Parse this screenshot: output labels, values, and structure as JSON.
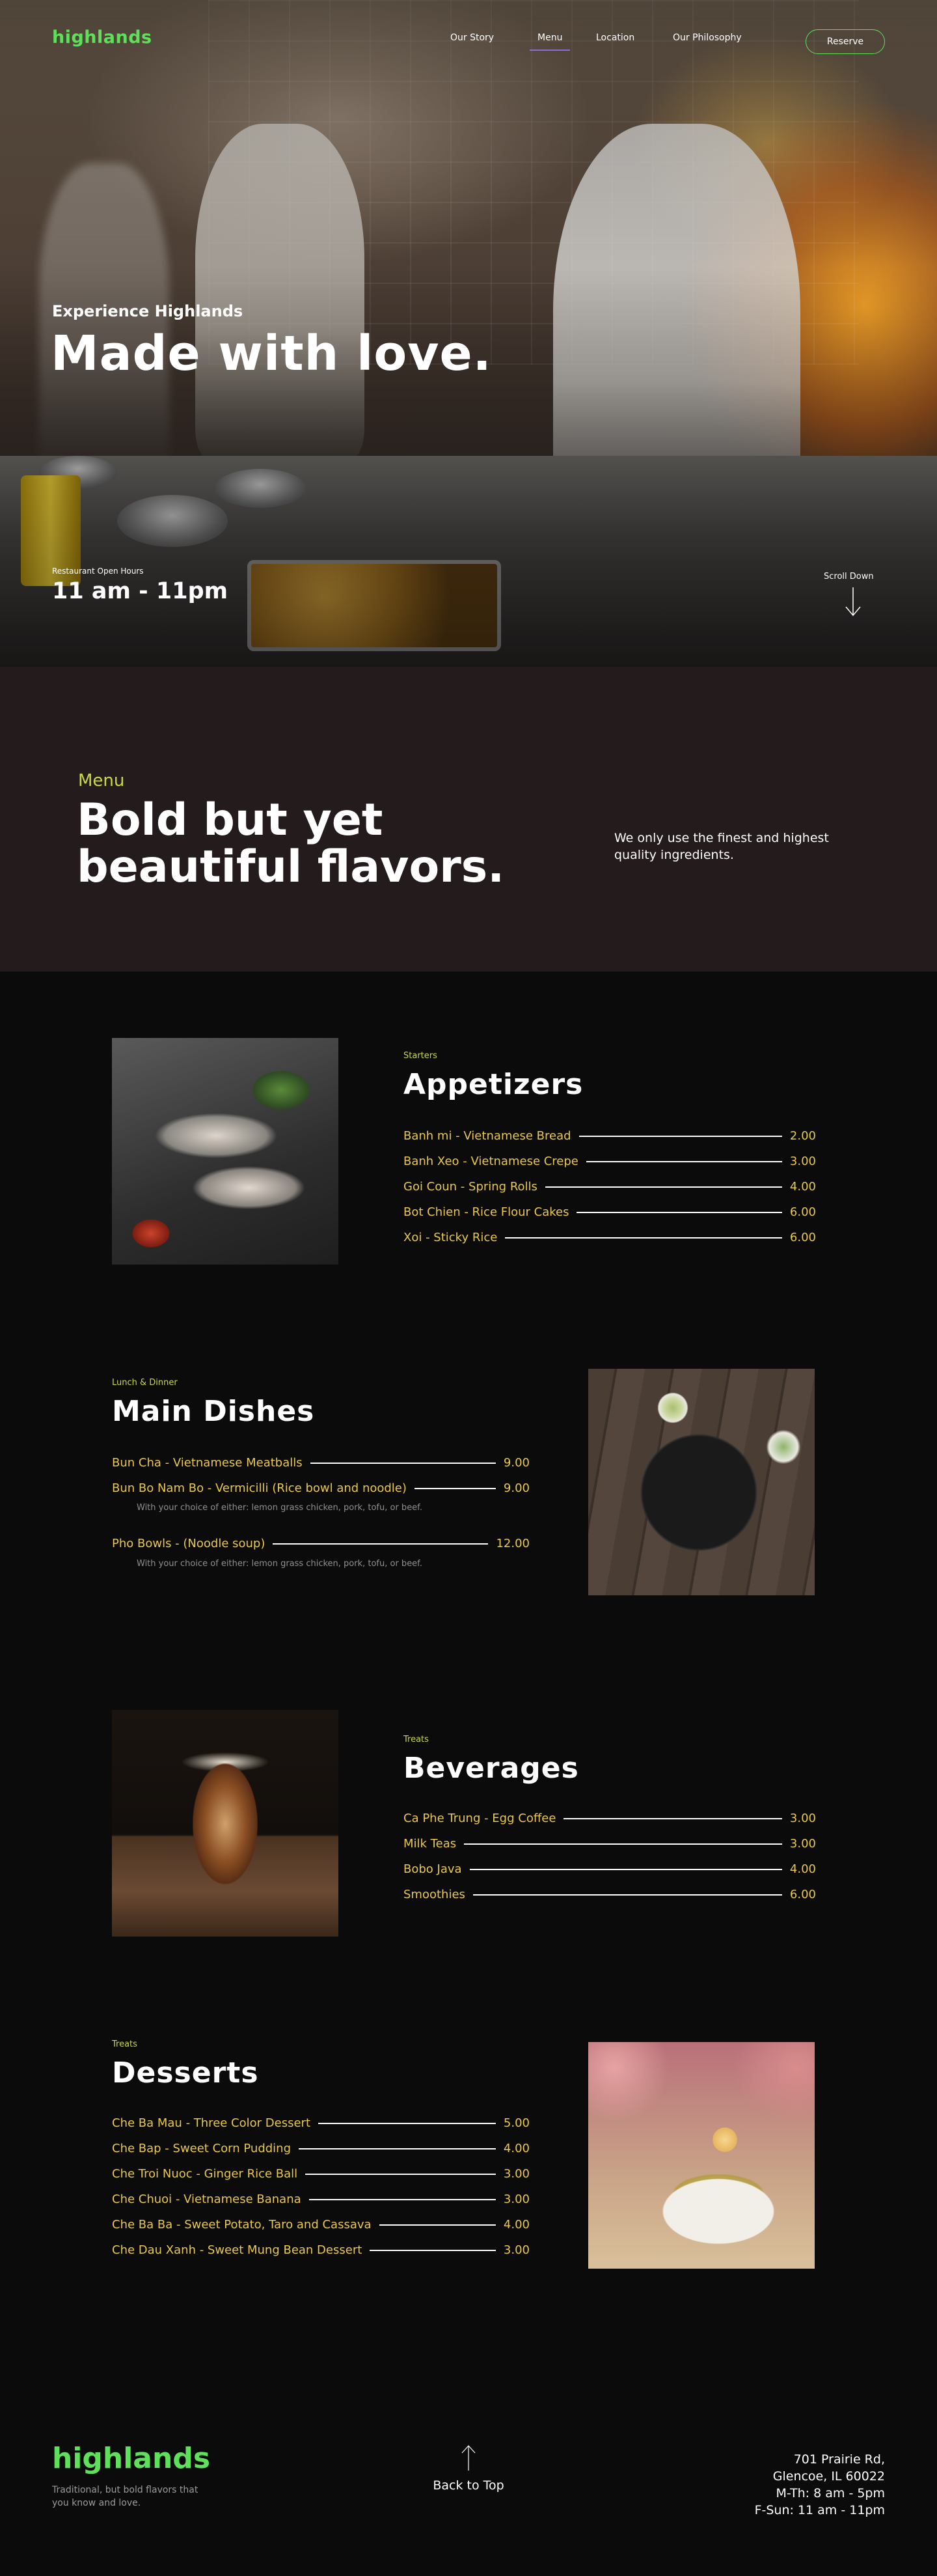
{
  "brand": {
    "logo": "highlands",
    "accent": "#5ee05a"
  },
  "nav": {
    "links": [
      "Our Story",
      "Menu",
      "Location",
      "Our Philosophy"
    ],
    "active": "Menu",
    "reserve_label": "Reserve"
  },
  "hero": {
    "eyebrow": "Experience Highlands",
    "title": "Made with love.",
    "hours_label": "Restaurant Open Hours",
    "hours_value": "11 am - 11pm",
    "scroll_label": "Scroll Down",
    "scroll_icon": "arrow-down-icon"
  },
  "intro": {
    "eyebrow": "Menu",
    "title": "Bold but yet beautiful flavors.",
    "text": "We only use the finest and highest quality ingredients."
  },
  "menu": {
    "appetizers": {
      "eyebrow": "Starters",
      "title": "Appetizers",
      "items": [
        {
          "name": "Banh mi - Vietnamese Bread",
          "price": "2.00"
        },
        {
          "name": "Banh Xeo - Vietnamese Crepe",
          "price": "3.00"
        },
        {
          "name": "Goi Coun - Spring Rolls",
          "price": "4.00"
        },
        {
          "name": "Bot Chien - Rice Flour Cakes",
          "price": "6.00"
        },
        {
          "name": "Xoi - Sticky Rice",
          "price": "6.00"
        }
      ]
    },
    "mains": {
      "eyebrow": "Lunch & Dinner",
      "title": "Main Dishes",
      "items": [
        {
          "name": "Bun Cha - Vietnamese Meatballs",
          "price": "9.00"
        },
        {
          "name": "Bun Bo Nam Bo - Vermicilli (Rice bowl and noodle)",
          "price": "9.00",
          "note": "With your choice of either: lemon grass chicken, pork, tofu, or beef."
        },
        {
          "name": "Pho Bowls - (Noodle soup)",
          "price": "12.00",
          "note": "With your choice of either: lemon grass chicken, pork, tofu, or beef."
        }
      ]
    },
    "beverages": {
      "eyebrow": "Treats",
      "title": "Beverages",
      "items": [
        {
          "name": "Ca Phe Trung - Egg Coffee",
          "price": "3.00"
        },
        {
          "name": "Milk Teas",
          "price": "3.00"
        },
        {
          "name": "Bobo Java",
          "price": "4.00"
        },
        {
          "name": "Smoothies",
          "price": "6.00"
        }
      ]
    },
    "desserts": {
      "eyebrow": "Treats",
      "title": "Desserts",
      "items": [
        {
          "name": "Che Ba Mau - Three Color Dessert",
          "price": "5.00"
        },
        {
          "name": "Che Bap - Sweet Corn Pudding",
          "price": "4.00"
        },
        {
          "name": "Che Troi Nuoc - Ginger Rice Ball",
          "price": "3.00"
        },
        {
          "name": "Che Chuoi - Vietnamese Banana",
          "price": "3.00"
        },
        {
          "name": "Che Ba Ba - Sweet Potato, Taro and Cassava",
          "price": "4.00"
        },
        {
          "name": "Che Dau Xanh - Sweet Mung Bean Dessert",
          "price": "3.00"
        }
      ]
    }
  },
  "footer": {
    "logo": "highlands",
    "tagline": "Traditional, but bold flavors that you know and love.",
    "back_to_top": "Back to Top",
    "address_line1": "701 Prairie Rd,",
    "address_line2": "Glencoe, IL 60022",
    "hours_line1": "M-Th: 8 am - 5pm",
    "hours_line2": "F-Sun: 11 am - 11pm"
  },
  "colors": {
    "item_text": "#e9c84b",
    "eyebrow": "#c9d845",
    "intro_bg": "#241c1c",
    "page_bg": "#0b0b0b"
  }
}
